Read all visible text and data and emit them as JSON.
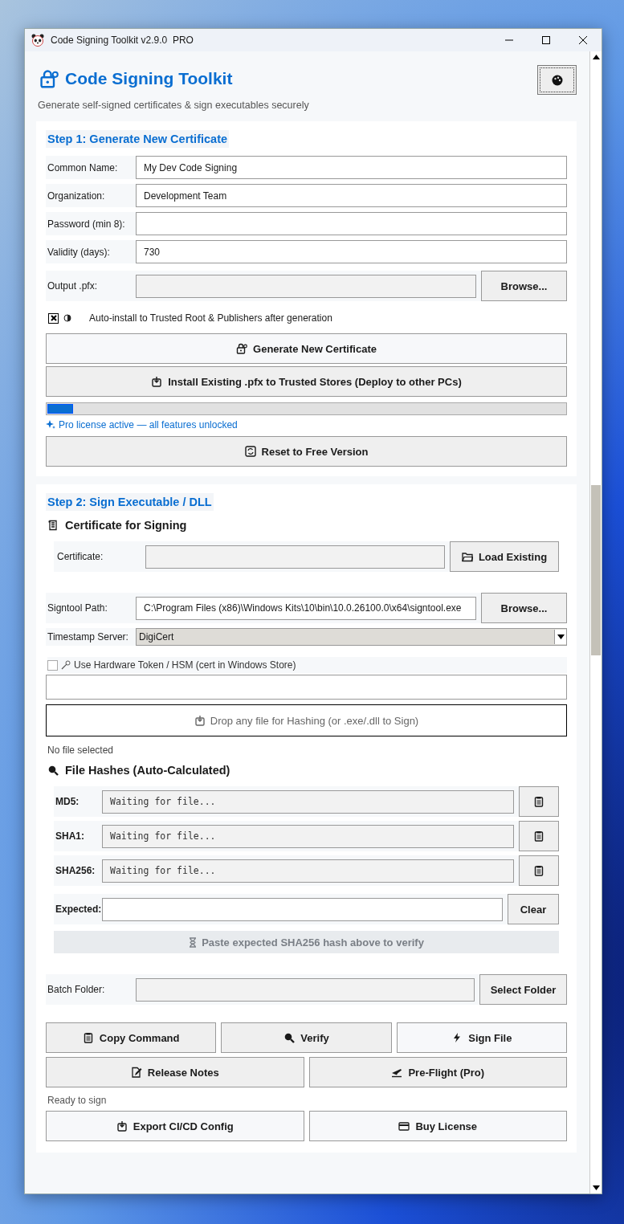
{
  "window": {
    "title": "Code Signing Toolkit v2.9.0  PRO"
  },
  "header": {
    "title": "Code Signing Toolkit",
    "subtitle": "Generate self-signed certificates & sign executables securely"
  },
  "step1": {
    "heading": "Step 1: Generate New Certificate",
    "fields": [
      {
        "kind": "text",
        "label": "Common Name:",
        "value": "My Dev Code Signing"
      },
      {
        "kind": "text",
        "label": "Organization:",
        "value": "Development Team"
      },
      {
        "kind": "text",
        "label": "Password (min 8):"
      },
      {
        "kind": "text",
        "label": "Validity (days):",
        "value": "730"
      },
      {
        "kind": "browse",
        "label": "Output .pfx:",
        "button": "Browse..."
      }
    ],
    "auto_install": {
      "checked": true,
      "label": "Auto-install to Trusted Root & Publishers after generation"
    },
    "generate_button": "Generate New Certificate",
    "install_button": "Install Existing .pfx to Trusted Stores (Deploy to other PCs)",
    "progress": {
      "level": 0.05
    },
    "license_status": "Pro license active — all features unlocked",
    "reset_button": "Reset to Free Version"
  },
  "step2": {
    "heading": "Step 2: Sign Executable / DLL",
    "certificate_heading": "Certificate for Signing",
    "certificate": {
      "label": "Certificate:",
      "button": "Load Existing"
    },
    "signtool": {
      "label": "Signtool Path:",
      "value": "C:\\Program Files (x86)\\Windows Kits\\10\\bin\\10.0.26100.0\\x64\\signtool.exe",
      "button": "Browse..."
    },
    "timestamp": {
      "label": "Timestamp Server:",
      "value": "DigiCert"
    },
    "hardware_token": {
      "checked": false,
      "label": "Use Hardware Token / HSM (cert in Windows Store)"
    },
    "drop_zone": "Drop any file for Hashing (or .exe/.dll to Sign)",
    "file_status": "No file selected",
    "hashes_heading": "File Hashes (Auto-Calculated)",
    "hashes": [
      {
        "label": "MD5:",
        "value": "Waiting for file..."
      },
      {
        "label": "SHA1:",
        "value": "Waiting for file..."
      },
      {
        "label": "SHA256:",
        "value": "Waiting for file..."
      }
    ],
    "expected": {
      "label": "Expected:",
      "button": "Clear"
    },
    "verify_status": "Paste expected SHA256 hash above to verify",
    "batch": {
      "label": "Batch Folder:",
      "button": "Select Folder"
    },
    "action_rows": [
      [
        "Copy Command",
        "Verify",
        "Sign File"
      ],
      [
        "Release Notes",
        "Pre-Flight (Pro)"
      ]
    ],
    "status": "Ready to sign",
    "bottom_buttons": [
      "Export CI/CD Config",
      "Buy License"
    ]
  }
}
